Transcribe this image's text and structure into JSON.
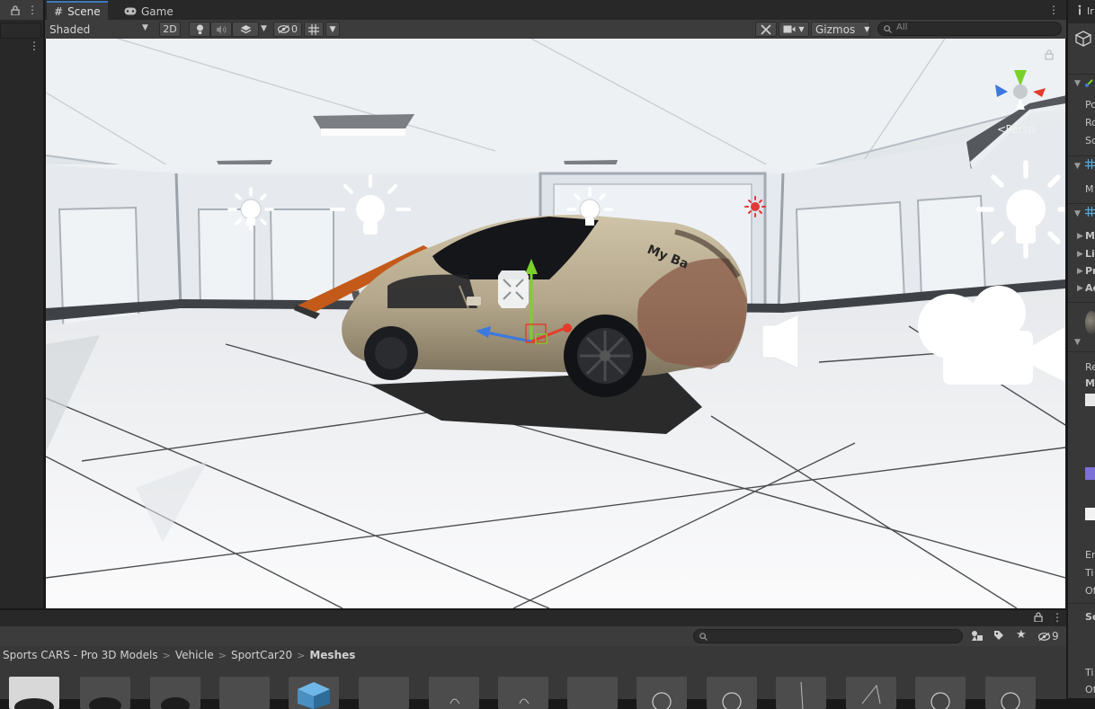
{
  "scene_window": {
    "tabs": [
      {
        "label": "Scene",
        "icon": "hash-icon",
        "active": true
      },
      {
        "label": "Game",
        "icon": "gamepad-icon",
        "active": false
      }
    ],
    "toolbar": {
      "shading_mode": "Shaded",
      "mode_2d": "2D",
      "hidden_count": "0",
      "gizmos": "Gizmos",
      "search_placeholder": "All"
    },
    "view_label": "Persp"
  },
  "inspector": {
    "tab_label_partial": "Ir",
    "transform_labels": [
      "Po",
      "Ro",
      "Sc"
    ],
    "mesh_label": "M",
    "renderer_labels": [
      "M",
      "Li",
      "Pr",
      "Ad"
    ],
    "material_labels": [
      "Re",
      "M"
    ],
    "lower_labels": [
      "En",
      "Ti",
      "Of",
      "Se",
      "Ti",
      "Of"
    ]
  },
  "project_window": {
    "breadcrumb": [
      "Sports CARS - Pro 3D Models",
      "Vehicle",
      "SportCar20",
      "Meshes"
    ],
    "hidden_count": "9",
    "asset_count": 15
  },
  "colors": {
    "panel_dark": "#282828",
    "panel": "#383838",
    "toolbar": "#3c3c3c",
    "accent_blue": "#3a79bb",
    "spoiler_orange": "#c45a1a",
    "gizmo_green": "#7bd12b",
    "gizmo_red": "#e53b2a",
    "gizmo_blue": "#3b78e0"
  }
}
